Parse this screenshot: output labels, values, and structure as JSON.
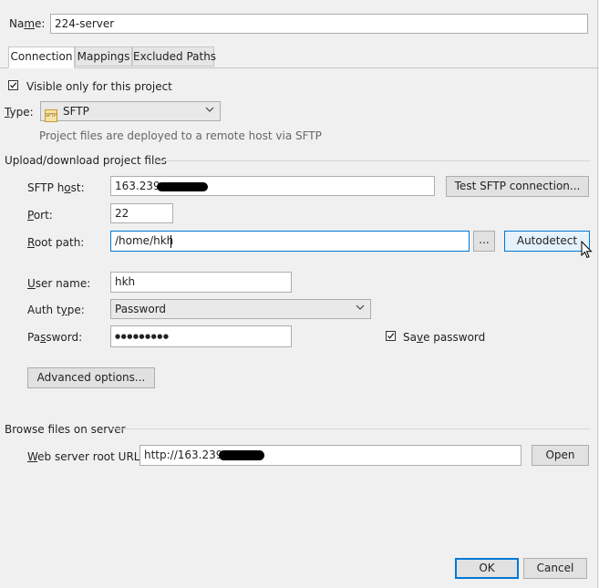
{
  "name": {
    "label": "Name:",
    "value": "224-server"
  },
  "tabs": [
    {
      "label": "Connection",
      "active": true
    },
    {
      "label": "Mappings",
      "active": false
    },
    {
      "label": "Excluded Paths",
      "active": false
    }
  ],
  "visible_only": {
    "label": "Visible only for this project",
    "checked": true
  },
  "type": {
    "label": "Type:",
    "value": "SFTP",
    "icon": "sftp-icon",
    "description": "Project files are deployed to a remote host via SFTP"
  },
  "upload_section": {
    "title": "Upload/download project files"
  },
  "sftp_host": {
    "label": "SFTP host:",
    "value": "163.239."
  },
  "test_button": {
    "label": "Test SFTP connection..."
  },
  "port": {
    "label": "Port:",
    "value": "22"
  },
  "root_path": {
    "label": "Root path:",
    "value": "/home/hkh",
    "browse_label": "...",
    "autodetect_label": "Autodetect"
  },
  "user_name": {
    "label": "User name:",
    "value": "hkh"
  },
  "auth_type": {
    "label": "Auth type:",
    "value": "Password"
  },
  "password": {
    "label": "Password:",
    "value": "●●●●●●●●●"
  },
  "save_password": {
    "label": "Save password",
    "checked": true
  },
  "advanced_button": {
    "label": "Advanced options..."
  },
  "browse_section": {
    "title": "Browse files on server"
  },
  "web_root": {
    "label": "Web server root URL:",
    "value": "http://163.239.",
    "open_label": "Open"
  },
  "footer": {
    "ok_label": "OK",
    "cancel_label": "Cancel"
  },
  "colors": {
    "accent_border": "#0078d7",
    "accent_bg": "#e5f1fb"
  }
}
